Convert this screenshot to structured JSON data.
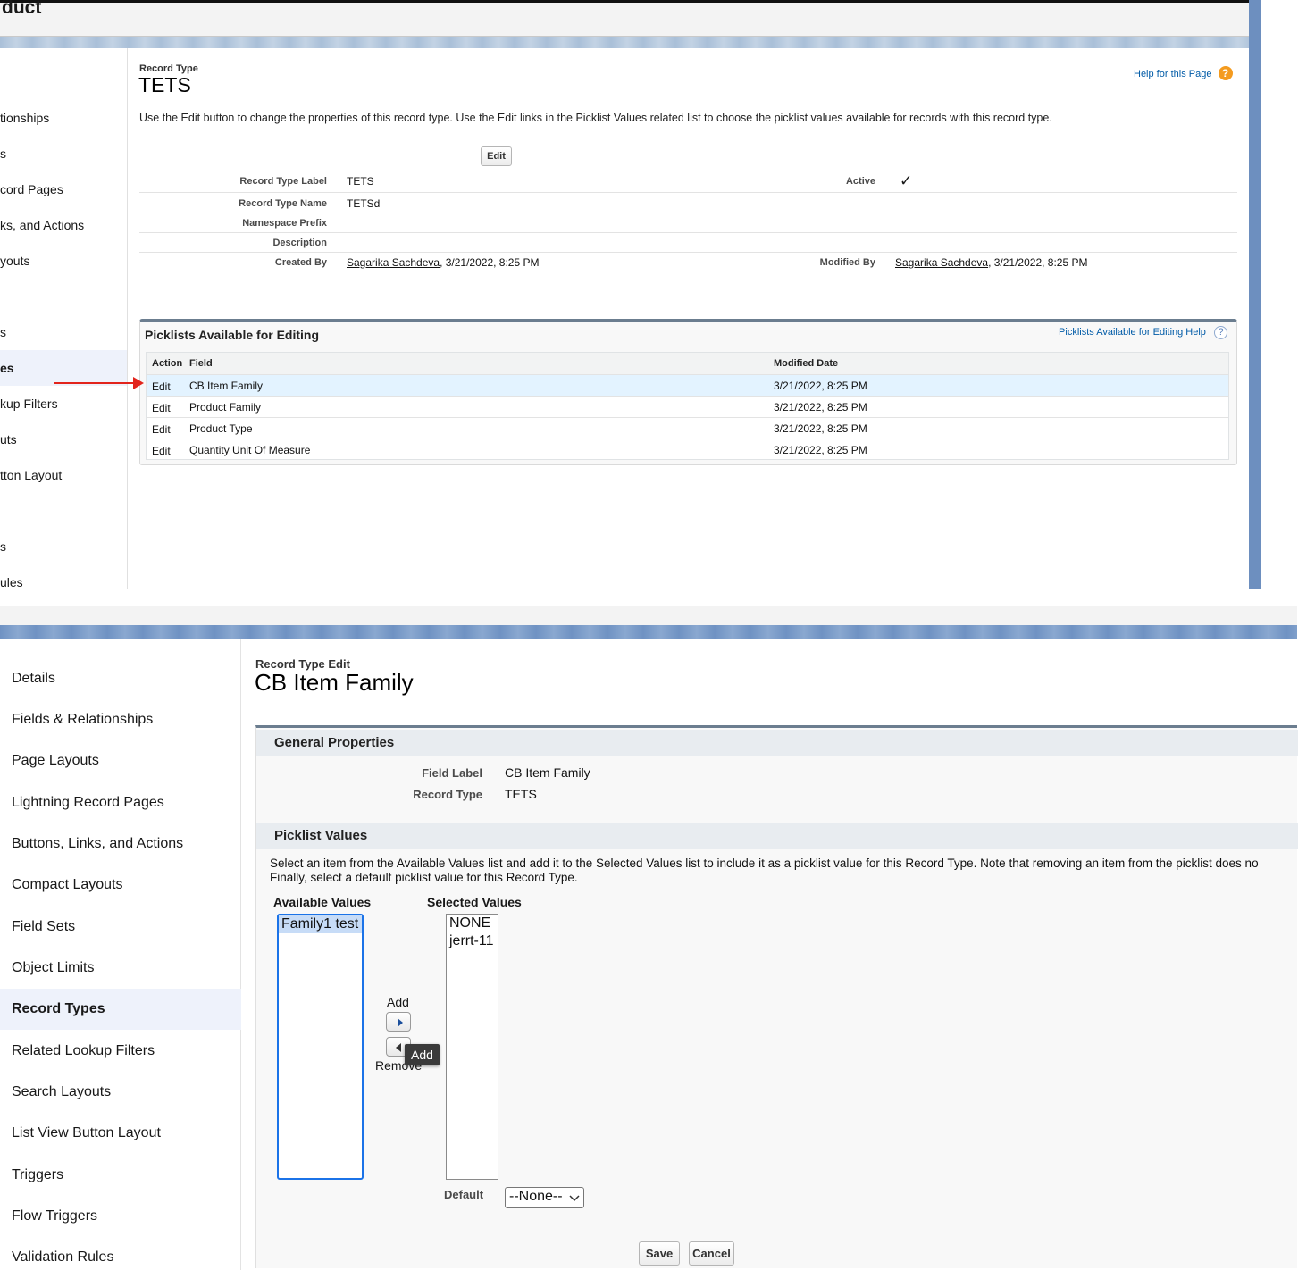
{
  "top": {
    "header_title": "duct",
    "sidebar_items": [
      "tionships",
      "s",
      "cord Pages",
      "ks, and Actions",
      "youts",
      "s",
      "es",
      "kup Filters",
      "uts",
      "tton Layout",
      "s",
      "ules"
    ],
    "record_type_caption": "Record Type",
    "record_type_title": "TETS",
    "help_link": "Help for this Page",
    "description_text": "Use the Edit button to change the properties of this record type. Use the Edit links in the Picklist Values related list to choose the picklist values available for records with this record type.",
    "edit_button": "Edit",
    "details": {
      "record_type_label_lbl": "Record Type Label",
      "record_type_label_val": "TETS",
      "active_lbl": "Active",
      "active_val": "✓",
      "record_type_name_lbl": "Record Type Name",
      "record_type_name_val": "TETSd",
      "namespace_prefix_lbl": "Namespace Prefix",
      "description_lbl": "Description",
      "created_by_lbl": "Created By",
      "created_by_user": "Sagarika Sachdeva",
      "created_by_date": ", 3/21/2022, 8:25 PM",
      "modified_by_lbl": "Modified By",
      "modified_by_user": "Sagarika Sachdeva",
      "modified_by_date": ", 3/21/2022, 8:25 PM"
    },
    "picklists": {
      "title": "Picklists Available for Editing",
      "help_link": "Picklists Available for Editing Help",
      "col_action": "Action",
      "col_field": "Field",
      "col_modified": "Modified Date",
      "rows": [
        {
          "action": "Edit",
          "field": "CB Item Family",
          "modified": "3/21/2022, 8:25 PM"
        },
        {
          "action": "Edit",
          "field": "Product Family",
          "modified": "3/21/2022, 8:25 PM"
        },
        {
          "action": "Edit",
          "field": "Product Type",
          "modified": "3/21/2022, 8:25 PM"
        },
        {
          "action": "Edit",
          "field": "Quantity Unit Of Measure",
          "modified": "3/21/2022, 8:25 PM"
        }
      ]
    }
  },
  "bottom": {
    "sidebar_items": [
      "Details",
      "Fields & Relationships",
      "Page Layouts",
      "Lightning Record Pages",
      "Buttons, Links, and Actions",
      "Compact Layouts",
      "Field Sets",
      "Object Limits",
      "Record Types",
      "Related Lookup Filters",
      "Search Layouts",
      "List View Button Layout",
      "Triggers",
      "Flow Triggers",
      "Validation Rules"
    ],
    "caption": "Record Type Edit",
    "title": "CB Item Family",
    "general_properties": "General Properties",
    "field_label_lbl": "Field Label",
    "field_label_val": "CB Item Family",
    "record_type_lbl": "Record Type",
    "record_type_val": "TETS",
    "picklist_values": "Picklist Values",
    "instructions_line1": "Select an item from the Available Values list and add it to the Selected Values list to include it as a picklist value for this Record Type. Note that removing an item from the picklist does no",
    "instructions_line2": "Finally, select a default picklist value for this Record Type.",
    "available_values_lbl": "Available Values",
    "selected_values_lbl": "Selected Values",
    "available_values": [
      "Family1 test"
    ],
    "selected_values": [
      "NONE",
      "jerrt-11"
    ],
    "add_lbl": "Add",
    "remove_lbl": "Remove",
    "tooltip": "Add",
    "default_lbl": "Default",
    "default_val": "--None--",
    "save_button": "Save",
    "cancel_button": "Cancel"
  }
}
